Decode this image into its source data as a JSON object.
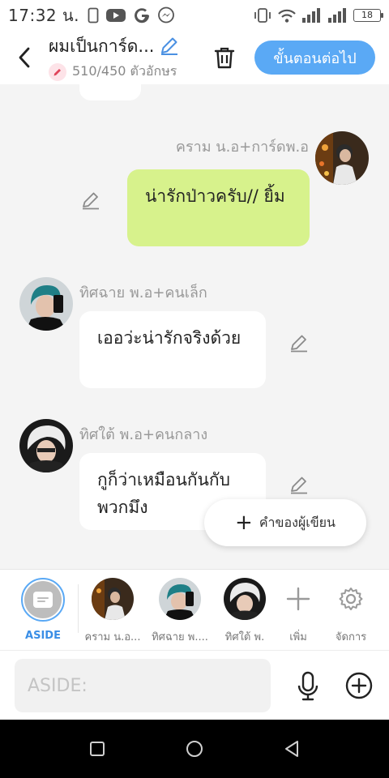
{
  "status_bar": {
    "time": "17:32 น.",
    "battery": "18",
    "left_icons": [
      "phone-outline-icon",
      "youtube-icon",
      "google-icon",
      "messenger-icon"
    ],
    "right_icons": [
      "vibrate-icon",
      "wifi-icon",
      "signal-icon",
      "signal-icon",
      "battery-icon"
    ]
  },
  "header": {
    "title": "ผมเป็นการ์ด...",
    "char_count": "510/450 ตัวอักษร",
    "next_label": "ขั้นตอนต่อไป",
    "accent_color": "#5aa9f5"
  },
  "messages": [
    {
      "sender": "คราม น.อ+การ์ดพ.อ",
      "text": "น่ารักป่าวครับ// ยิ้ม",
      "side": "right",
      "bubble_color": "#d7f28c"
    },
    {
      "sender": "ทิศฉาย พ.อ+คนเล็ก",
      "text": "เออว่ะน่ารักจริงด้วย",
      "side": "left",
      "bubble_color": "#ffffff"
    },
    {
      "sender": "ทิศใต้ พ.อ+คนกลาง",
      "text": "กูก็ว่าเหมือนกันกับพวกมึง",
      "side": "left",
      "bubble_color": "#ffffff"
    }
  ],
  "fab": {
    "label": "คำของผู้เขียน"
  },
  "char_bar": {
    "aside_label": "ASIDE",
    "characters": [
      {
        "label": "คราม น.อ..."
      },
      {
        "label": "ทิศฉาย พ...."
      },
      {
        "label": "ทิศใต้ พ."
      }
    ],
    "add_label": "เพิ่ม",
    "manage_label": "จัดการ"
  },
  "input": {
    "placeholder": "ASIDE:"
  }
}
